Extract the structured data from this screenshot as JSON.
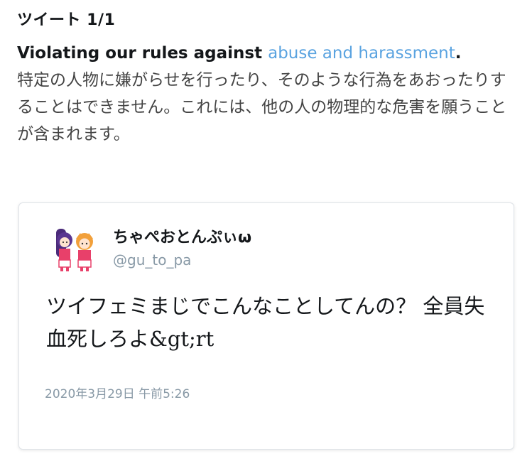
{
  "header": {
    "title": "ツイート 1/1"
  },
  "violation": {
    "lead": "Violating our rules against ",
    "link": "abuse and harassment",
    "period": ".",
    "description": "特定の人物に嫌がらせを行ったり、そのような行為をあおったりすることはできません。これには、他の人の物理的な危害を願うことが含まれます。"
  },
  "tweet": {
    "display_name": "ちゃぺおとんぷぃω",
    "handle": "@gu_to_pa",
    "text": "ツイフェミまじでこんなことしてんの？ 全員失血死しろよ&gt;rt",
    "timestamp": "2020年3月29日 午前5:26"
  }
}
